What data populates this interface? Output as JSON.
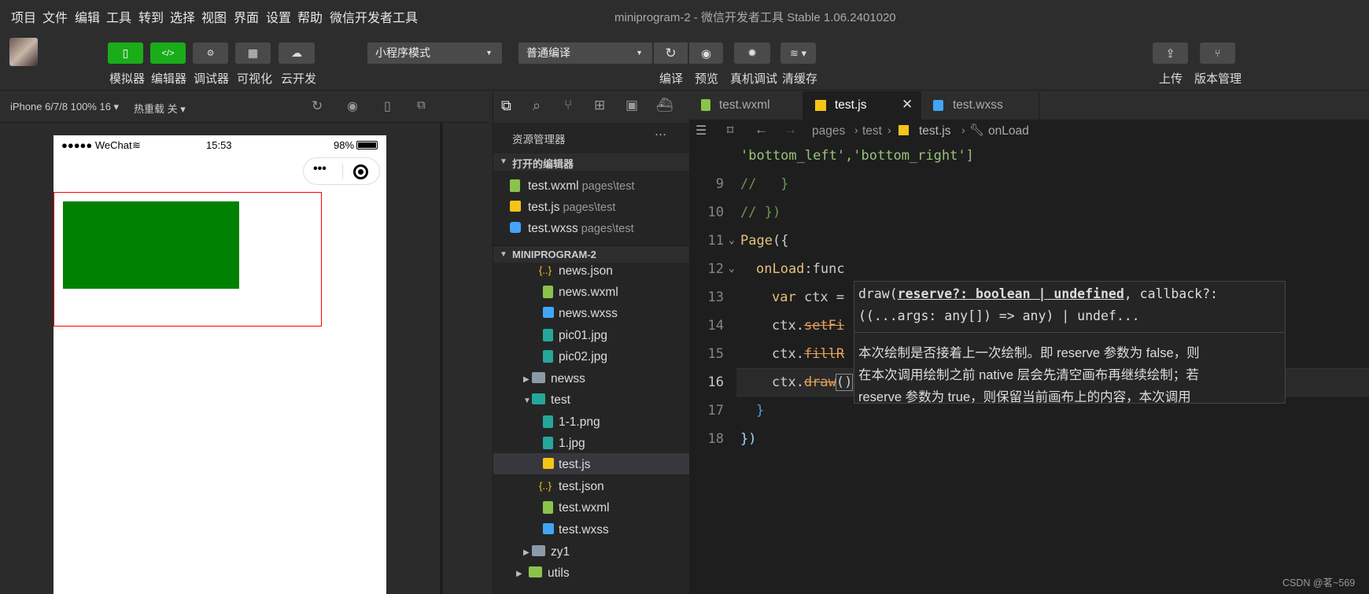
{
  "menu": [
    "项目",
    "文件",
    "编辑",
    "工具",
    "转到",
    "选择",
    "视图",
    "界面",
    "设置",
    "帮助",
    "微信开发者工具"
  ],
  "window_title": "miniprogram-2 - 微信开发者工具 Stable 1.06.2401020",
  "toolbar": {
    "simulator": "模拟器",
    "editor": "编辑器",
    "debugger": "调试器",
    "visual": "可视化",
    "cloud": "云开发",
    "mode_select": "小程序模式",
    "compile_select": "普通编译",
    "compile": "编译",
    "preview": "预览",
    "real_debug": "真机调试",
    "clear_cache": "清缓存",
    "upload": "上传",
    "version": "版本管理"
  },
  "sim_bar": {
    "device": "iPhone 6/7/8 100% 16 ▾",
    "hot_reload": "热重载 关 ▾"
  },
  "phone": {
    "carrier": "●●●●● WeChat",
    "time": "15:53",
    "battery": "98%",
    "menu_dots": "•••"
  },
  "explorer": {
    "title": "资源管理器",
    "more": "···",
    "open_editors_label": "打开的编辑器",
    "open_editors": [
      {
        "name": "test.wxml",
        "path": "pages\\test"
      },
      {
        "name": "test.js",
        "path": "pages\\test"
      },
      {
        "name": "test.wxss",
        "path": "pages\\test"
      }
    ],
    "project_label": "MINIPROGRAM-2",
    "tree": [
      "news.json",
      "news.wxml",
      "news.wxss",
      "pic01.jpg",
      "pic02.jpg",
      "newss",
      "test",
      "1-1.png",
      "1.jpg",
      "test.js",
      "test.json",
      "test.wxml",
      "test.wxss",
      "zy1",
      "utils"
    ]
  },
  "tabs": [
    "test.wxml",
    "test.js",
    "test.wxss"
  ],
  "breadcrumb": {
    "pages": "pages",
    "test": "test",
    "file": "test.js",
    "symbol": "onLoad"
  },
  "code": {
    "line_top": "'bottom_left','bottom_right']",
    "l9": "//   }",
    "l10": "// })",
    "l11_kw": "Page",
    "l11_rest": "({",
    "l12_fn": "onLoad",
    "l12_rest": ":func",
    "l13_kw": "var",
    "l13_rest": " ctx =",
    "l14_a": "ctx.",
    "l14_b": "setFi",
    "l15_a": "ctx.",
    "l15_b": "fillR",
    "l16_a": "ctx.",
    "l16_b": "draw",
    "l16_c": "()",
    "l17": "}",
    "l18": "})",
    "numbers": [
      "9",
      "10",
      "11",
      "12",
      "13",
      "14",
      "15",
      "16",
      "17",
      "18"
    ]
  },
  "hover": {
    "sig1_a": "draw(",
    "sig1_b": "reserve?: boolean | undefined",
    "sig1_c": ", callback?:",
    "sig2": "((...args: any[]) => any) | undef...",
    "doc1": "本次绘制是否接着上一次绘制。即 reserve 参数为 false，则",
    "doc2": "在本次调用绘制之前 native 层会先清空画布再继续绘制；若",
    "doc3": "reserve 参数为 true，则保留当前画布上的内容，本次调用"
  },
  "watermark": "CSDN @茗~569",
  "colors": {
    "accent_green": "#1aad19",
    "canvas_fill": "#008000",
    "canvas_border": "#ff0000"
  }
}
